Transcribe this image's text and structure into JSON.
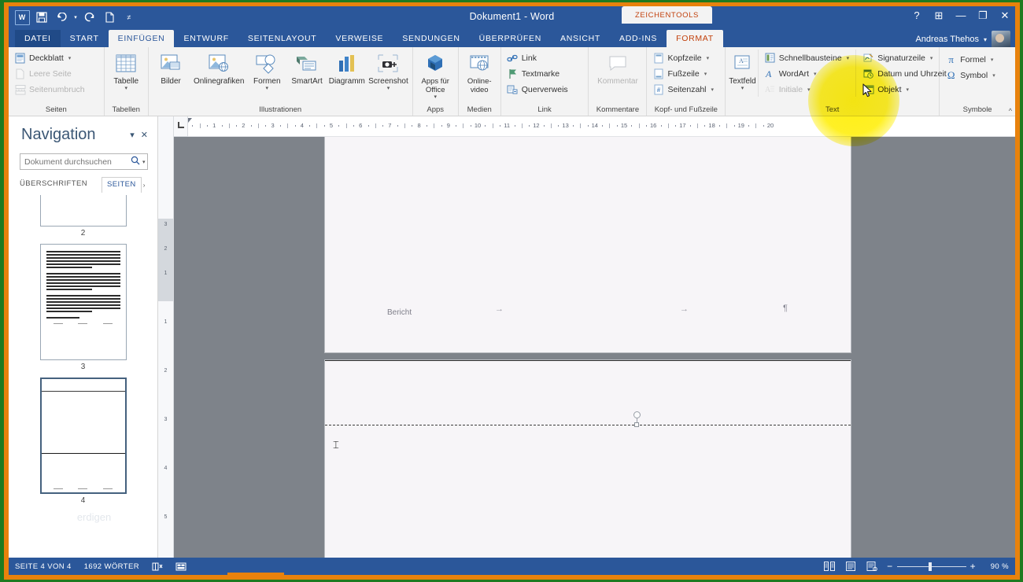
{
  "window": {
    "title": "Dokument1 - Word",
    "contextual_tab_label": "ZEICHENTOOLS",
    "account_name": "Andreas Thehos",
    "account_caret": "▾",
    "quick_access": [
      {
        "name": "word-logo-icon",
        "glyph": "W"
      },
      {
        "name": "save-icon",
        "glyph": "💾"
      },
      {
        "name": "undo-icon",
        "glyph": "↶"
      },
      {
        "name": "redo-icon",
        "glyph": "↷"
      },
      {
        "name": "new-doc-icon",
        "glyph": "🗋"
      },
      {
        "name": "customize-qat-icon",
        "glyph": "▾"
      }
    ],
    "buttons": {
      "help": "?",
      "ribbon_display": "⊞",
      "minimize": "—",
      "restore": "❐",
      "close": "✕"
    }
  },
  "tabs": [
    {
      "label": "DATEI",
      "state": "file"
    },
    {
      "label": "START",
      "state": "normal"
    },
    {
      "label": "EINFÜGEN",
      "state": "active"
    },
    {
      "label": "ENTWURF",
      "state": "normal"
    },
    {
      "label": "SEITENLAYOUT",
      "state": "normal"
    },
    {
      "label": "VERWEISE",
      "state": "normal"
    },
    {
      "label": "SENDUNGEN",
      "state": "normal"
    },
    {
      "label": "ÜBERPRÜFEN",
      "state": "normal"
    },
    {
      "label": "ANSICHT",
      "state": "normal"
    },
    {
      "label": "ADD-INS",
      "state": "normal"
    },
    {
      "label": "FORMAT",
      "state": "contextual"
    }
  ],
  "ribbon": {
    "collapse_label": "^",
    "groups": [
      {
        "title": "Seiten",
        "items": [
          {
            "label": "Deckblatt",
            "icon": "cover-page-icon",
            "caret": "▾",
            "disabled": false,
            "type": "small"
          },
          {
            "label": "Leere Seite",
            "icon": "blank-page-icon",
            "caret": "",
            "disabled": true,
            "type": "small"
          },
          {
            "label": "Seitenumbruch",
            "icon": "page-break-icon",
            "caret": "",
            "disabled": true,
            "type": "small"
          }
        ]
      },
      {
        "title": "Tabellen",
        "items": [
          {
            "label": "Tabelle",
            "icon": "table-icon",
            "caret": "▾",
            "disabled": false,
            "type": "big"
          }
        ]
      },
      {
        "title": "Illustrationen",
        "items": [
          {
            "label": "Bilder",
            "icon": "pictures-icon",
            "caret": "",
            "disabled": false,
            "type": "big"
          },
          {
            "label": "Onlinegrafiken",
            "icon": "online-pictures-icon",
            "caret": "",
            "disabled": false,
            "type": "big"
          },
          {
            "label": "Formen",
            "icon": "shapes-icon",
            "caret": "▾",
            "disabled": false,
            "type": "big"
          },
          {
            "label": "SmartArt",
            "icon": "smartart-icon",
            "caret": "",
            "disabled": false,
            "type": "big"
          },
          {
            "label": "Diagramm",
            "icon": "chart-icon",
            "caret": "",
            "disabled": false,
            "type": "big"
          },
          {
            "label": "Screenshot",
            "icon": "screenshot-icon",
            "caret": "▾",
            "disabled": false,
            "type": "big"
          }
        ]
      },
      {
        "title": "Apps",
        "items": [
          {
            "label": "Apps für Office",
            "icon": "apps-for-office-icon",
            "caret": "▾",
            "disabled": false,
            "type": "big"
          }
        ]
      },
      {
        "title": "Medien",
        "items": [
          {
            "label": "Online-video",
            "icon": "online-video-icon",
            "caret": "",
            "disabled": false,
            "type": "big"
          }
        ]
      },
      {
        "title": "Link",
        "items": [
          {
            "label": "Link",
            "icon": "hyperlink-icon",
            "caret": "",
            "disabled": false,
            "type": "small"
          },
          {
            "label": "Textmarke",
            "icon": "bookmark-icon",
            "caret": "",
            "disabled": false,
            "type": "small"
          },
          {
            "label": "Querverweis",
            "icon": "cross-reference-icon",
            "caret": "",
            "disabled": false,
            "type": "small"
          }
        ]
      },
      {
        "title": "Kommentare",
        "items": [
          {
            "label": "Kommentar",
            "icon": "comment-icon",
            "caret": "",
            "disabled": true,
            "type": "big"
          }
        ]
      },
      {
        "title": "Kopf- und Fußzeile",
        "items": [
          {
            "label": "Kopfzeile",
            "icon": "header-icon",
            "caret": "▾",
            "disabled": false,
            "type": "small"
          },
          {
            "label": "Fußzeile",
            "icon": "footer-icon",
            "caret": "▾",
            "disabled": false,
            "type": "small"
          },
          {
            "label": "Seitenzahl",
            "icon": "page-number-icon",
            "caret": "▾",
            "disabled": false,
            "type": "small"
          }
        ]
      },
      {
        "title": "Text",
        "items": [
          {
            "label": "Textfeld",
            "icon": "text-box-icon",
            "caret": "▾",
            "disabled": false,
            "type": "big"
          },
          {
            "label": "Schnellbausteine",
            "icon": "quick-parts-icon",
            "caret": "▾",
            "disabled": false,
            "type": "small"
          },
          {
            "label": "WordArt",
            "icon": "wordart-icon",
            "caret": "▾",
            "disabled": false,
            "type": "small"
          },
          {
            "label": "Initiale",
            "icon": "drop-cap-icon",
            "caret": "▾",
            "disabled": true,
            "type": "small"
          },
          {
            "label": "Signaturzeile",
            "icon": "signature-line-icon",
            "caret": "▾",
            "disabled": false,
            "type": "small"
          },
          {
            "label": "Datum und Uhrzeit",
            "icon": "date-time-icon",
            "caret": "",
            "disabled": false,
            "type": "small"
          },
          {
            "label": "Objekt",
            "icon": "object-icon",
            "caret": "▾",
            "disabled": false,
            "type": "small"
          }
        ]
      },
      {
        "title": "Symbole",
        "items": [
          {
            "label": "Formel",
            "icon": "equation-icon",
            "caret": "▾",
            "disabled": false,
            "type": "small"
          },
          {
            "label": "Symbol",
            "icon": "symbol-icon",
            "caret": "▾",
            "disabled": false,
            "type": "small"
          }
        ]
      }
    ]
  },
  "navigation": {
    "title": "Navigation",
    "dropdown_caret": "▾",
    "close_glyph": "✕",
    "search": {
      "value": "",
      "placeholder": "Dokument durchsuchen",
      "icon": "search-icon",
      "caret": "▾"
    },
    "tabs": [
      {
        "label": "ÜBERSCHRIFTEN",
        "selected": false
      },
      {
        "label": "SEITEN",
        "selected": true
      }
    ],
    "thumbnails": [
      {
        "number": "2",
        "selected": false
      },
      {
        "number": "3",
        "selected": false
      },
      {
        "number": "4",
        "selected": true
      }
    ],
    "footer_ghost": "erdigen"
  },
  "ruler": {
    "horizontal_numbers": [
      "1",
      "2",
      "3",
      "4",
      "5",
      "6",
      "7",
      "8",
      "9",
      "10",
      "11",
      "12",
      "13",
      "14",
      "15",
      "16",
      "17",
      "18",
      "19",
      "20"
    ],
    "vertical_numbers_upper": [
      "3",
      "2",
      "1"
    ],
    "vertical_numbers_lower": [
      "1",
      "2",
      "3",
      "4",
      "5"
    ]
  },
  "document": {
    "page1": {
      "header_text": "Bericht",
      "tab_arrow": "→",
      "pilcrow": "¶"
    },
    "page2": {
      "caret_glyph": "⌶"
    }
  },
  "statusbar": {
    "page_info": "SEITE 4 VON 4",
    "word_count": "1692 WÖRTER",
    "proofing_icon": "proofing-errors-icon",
    "macro_icon": "macro-record-icon",
    "views": [
      {
        "name": "read-mode-icon",
        "glyph": "▤"
      },
      {
        "name": "print-layout-icon",
        "glyph": "▤"
      },
      {
        "name": "web-layout-icon",
        "glyph": "▤"
      }
    ],
    "zoom_minus": "−",
    "zoom_plus": "+",
    "zoom_value": "90 %"
  },
  "colors": {
    "word_blue": "#2b579a",
    "ribbon_bg": "#f3f3f3",
    "contextual_orange": "#c2410c",
    "highlight_yellow": "#ffee00",
    "frame_green": "#1f7a1f",
    "frame_orange": "#e8820c"
  }
}
